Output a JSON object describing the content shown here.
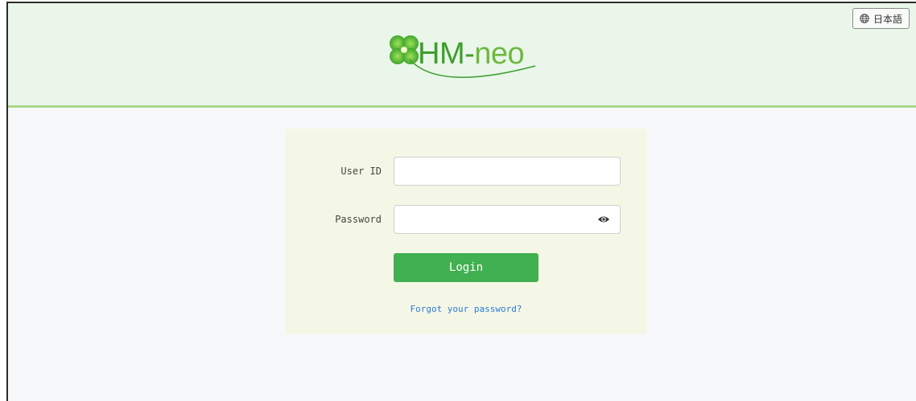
{
  "header": {
    "language_button": "日本語",
    "logo": {
      "text_main": "HM-",
      "text_light": "neo"
    }
  },
  "login": {
    "user_id_label": "User ID",
    "user_id_value": "",
    "password_label": "Password",
    "password_value": "",
    "login_label": "Login",
    "forgot_label": "Forgot your password?"
  },
  "icons": {
    "language": "globe-icon",
    "logo_mark": "clover-icon",
    "password_toggle": "eye-icon"
  },
  "colors": {
    "header_bg": "#e9f6e9",
    "header_border": "#a9d78a",
    "card_bg": "#f5f7e6",
    "accent": "#41b050",
    "link": "#2a7bd8"
  }
}
